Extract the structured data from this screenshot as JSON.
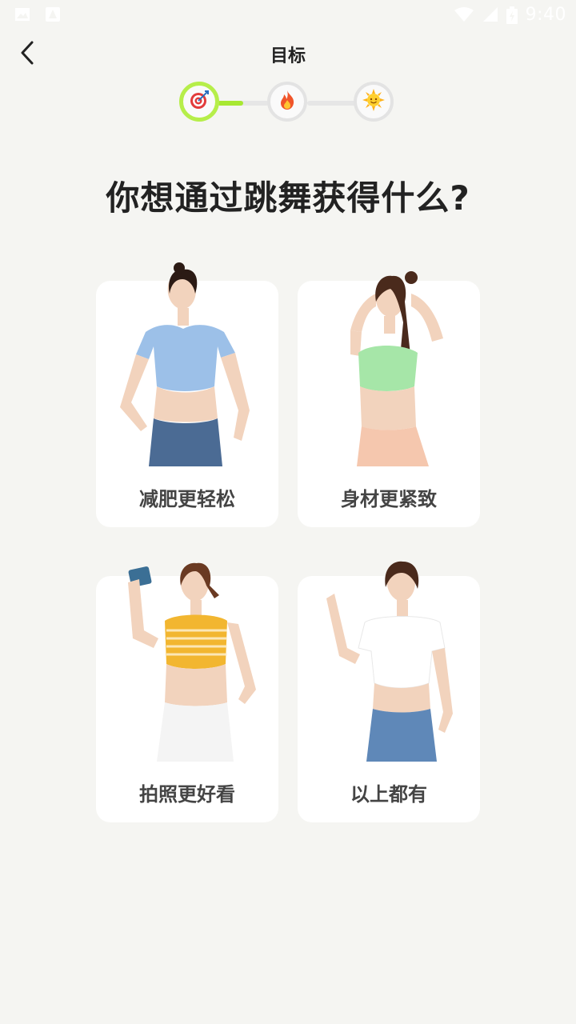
{
  "status_bar": {
    "time": "9:40"
  },
  "header": {
    "title": "目标"
  },
  "progress": {
    "steps": [
      {
        "icon": "target-icon",
        "glyph": "🎯",
        "active": true
      },
      {
        "icon": "fire-icon",
        "glyph": "🔥",
        "active": false
      },
      {
        "icon": "sun-icon",
        "glyph": "🌞",
        "active": false
      }
    ],
    "fraction": 0.5,
    "accent": "#b6ee4a"
  },
  "question": "你想通过跳舞获得什么?",
  "options": [
    {
      "label": "减肥更轻松",
      "top_color": "#9cc0e8",
      "bottom_color": "#4b6b94"
    },
    {
      "label": "身材更紧致",
      "top_color": "#a6e6a8",
      "bottom_color": "#f5c7ae"
    },
    {
      "label": "拍照更好看",
      "top_color": "#f2b630",
      "bottom_color": "#f4f4f4"
    },
    {
      "label": "以上都有",
      "top_color": "#ffffff",
      "bottom_color": "#5f88b8"
    }
  ]
}
